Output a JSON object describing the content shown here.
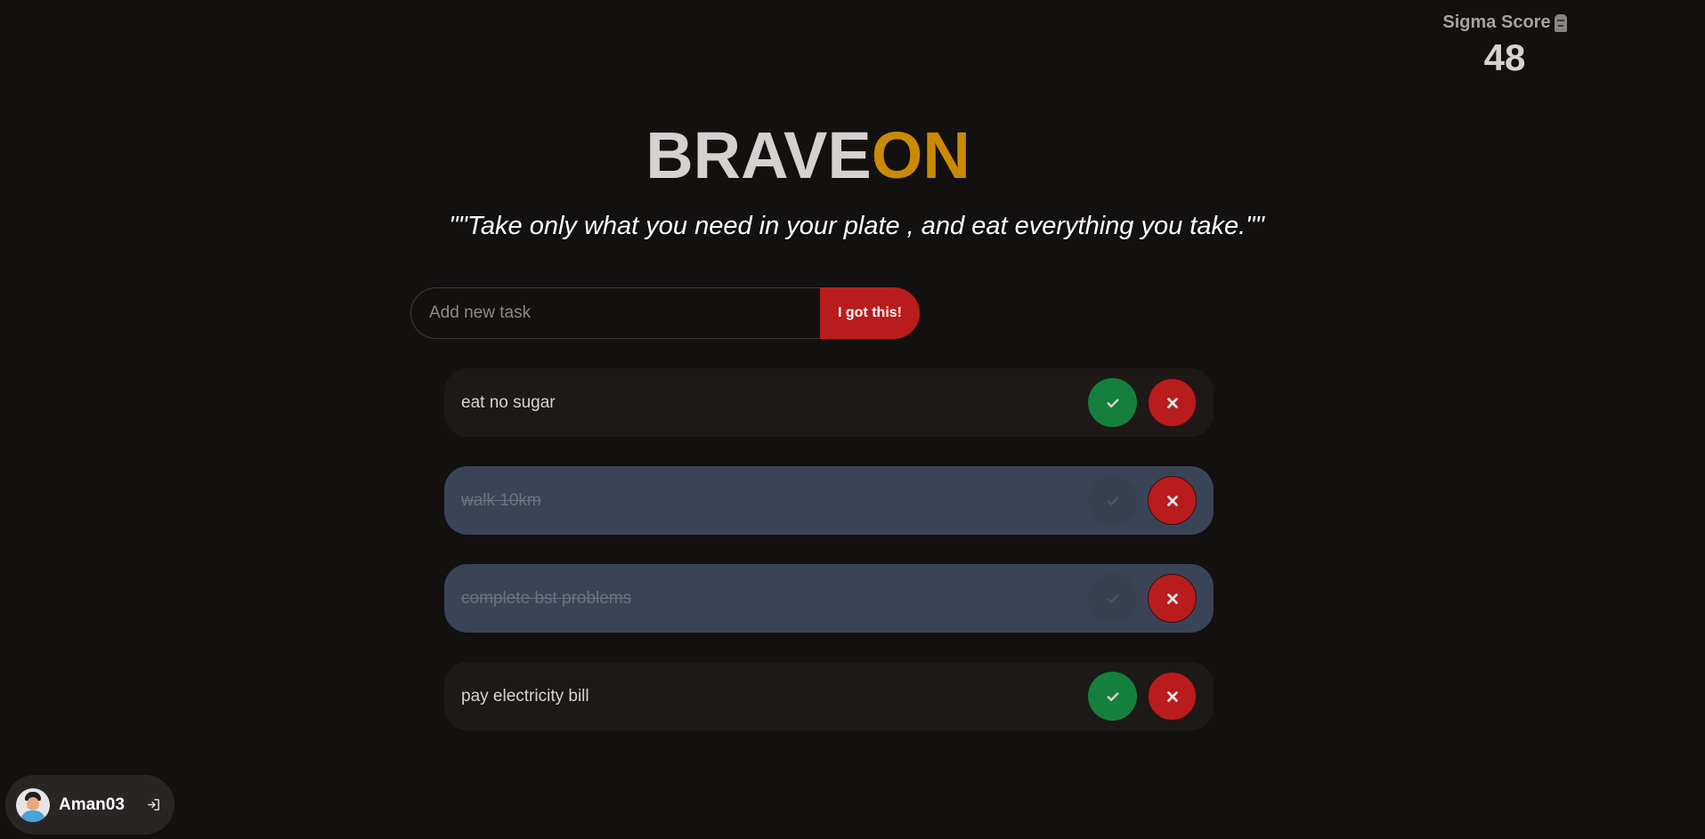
{
  "score": {
    "label": "Sigma Score",
    "value": "48",
    "icon": "moai-icon"
  },
  "title": {
    "part1": "BRAVE",
    "part2": "ON"
  },
  "quote": "\"\"Take only what you need in your plate , and eat everything you take.\"\"",
  "add_task": {
    "placeholder": "Add new task",
    "value": "",
    "button_label": "I got this!"
  },
  "tasks": [
    {
      "text": "eat no sugar",
      "completed": false
    },
    {
      "text": "walk 10km",
      "completed": true
    },
    {
      "text": "complete bst problems",
      "completed": true
    },
    {
      "text": "pay electricity bill",
      "completed": false
    }
  ],
  "user": {
    "name": "Aman03",
    "logout_icon": "logout-icon"
  },
  "colors": {
    "background": "#131010",
    "accent": "#ca8a04",
    "danger": "#b91c1c",
    "success": "#15803d",
    "task_bg": "#1c1917",
    "task_done_bg": "#3b4457"
  }
}
